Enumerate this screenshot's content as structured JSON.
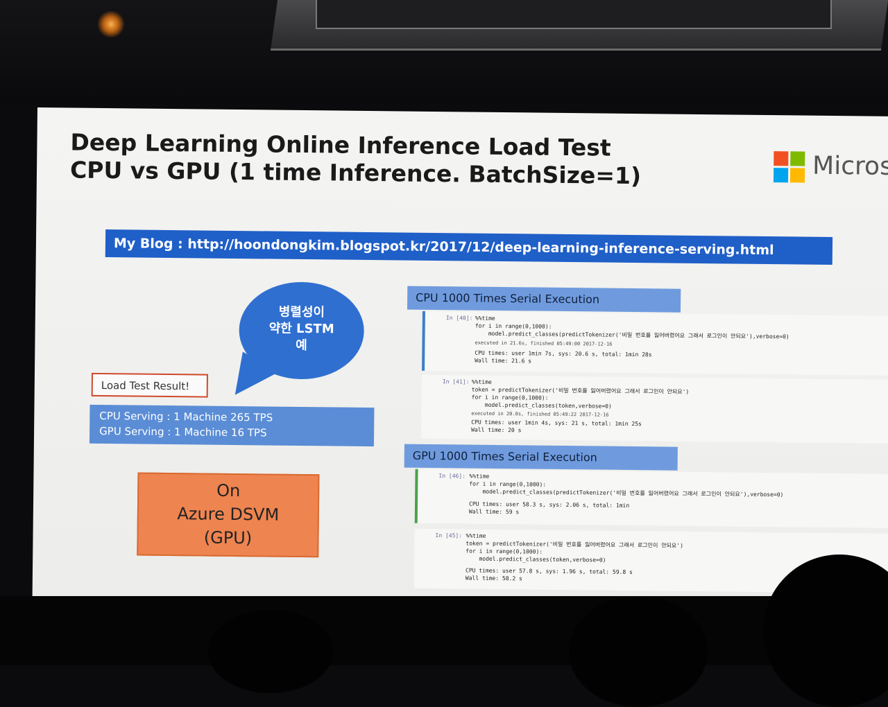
{
  "slide": {
    "title_line1": "Deep Learning Online Inference Load Test",
    "title_line2": "CPU vs GPU (1 time Inference. BatchSize=1)",
    "brand_text": "Micros",
    "blog_bar": "My Blog : http://hoondongkim.blogspot.kr/2017/12/deep-learning-inference-serving.html",
    "bubble_lines": [
      "병렬성이",
      "약한 LSTM",
      "예"
    ],
    "result_label": "Load Test Result!",
    "serving_lines": [
      "CPU Serving : 1 Machine 265 TPS",
      "GPU Serving : 1 Machine 16 TPS"
    ],
    "azure_lines": [
      "On",
      "Azure DSVM",
      "(GPU)"
    ],
    "cpu_header": "CPU 1000 Times Serial Execution",
    "gpu_header": "GPU 1000 Times Serial Execution",
    "cpu_cells": [
      {
        "prompt": "In [40]:",
        "code": "%%time\nfor i in range(0,1000):\n    model.predict_classes(predictTokenizer('비밀 번호를 잃어버렸어요 그래서 로그인이 안되요'),verbose=0)",
        "meta": "executed in 21.6s, finished 05:49:00 2017-12-16",
        "output": "CPU times: user 1min 7s, sys: 20.6 s, total: 1min 28s\nWall time: 21.6 s"
      },
      {
        "prompt": "In [41]:",
        "code": "%%time\ntoken = predictTokenizer('비밀 번호를 잃어버렸어요 그래서 로그인이 안되요')\nfor i in range(0,1000):\n    model.predict_classes(token,verbose=0)",
        "meta": "executed in 20.0s, finished 05:49:22 2017-12-16",
        "output": "CPU times: user 1min 4s, sys: 21 s, total: 1min 25s\nWall time: 20 s"
      }
    ],
    "gpu_cells": [
      {
        "prompt": "In [46]:",
        "code": "%%time\nfor i in range(0,1000):\n    model.predict_classes(predictTokenizer('비밀 번호를 잃어버렸어요 그래서 로그인이 안되요'),verbose=0)",
        "output": "CPU times: user 58.3 s, sys: 2.06 s, total: 1min\nWall time: 59 s"
      },
      {
        "prompt": "In [45]:",
        "code": "%%time\ntoken = predictTokenizer('비밀 번호를 잃어버렸어요 그래서 로그인이 안되요')\nfor i in range(0,1000):\n    model.predict_classes(token,verbose=0)",
        "output": "CPU times: user 57.8 s, sys: 1.96 s, total: 59.8 s\nWall time: 58.2 s"
      }
    ],
    "colors": {
      "blog_bar": "#1f5fc8",
      "bubble": "#2f6fd0",
      "azure_box": "#ee8450",
      "exec_header": "#6f9bde",
      "serving_box": "#5b8dd6"
    }
  }
}
